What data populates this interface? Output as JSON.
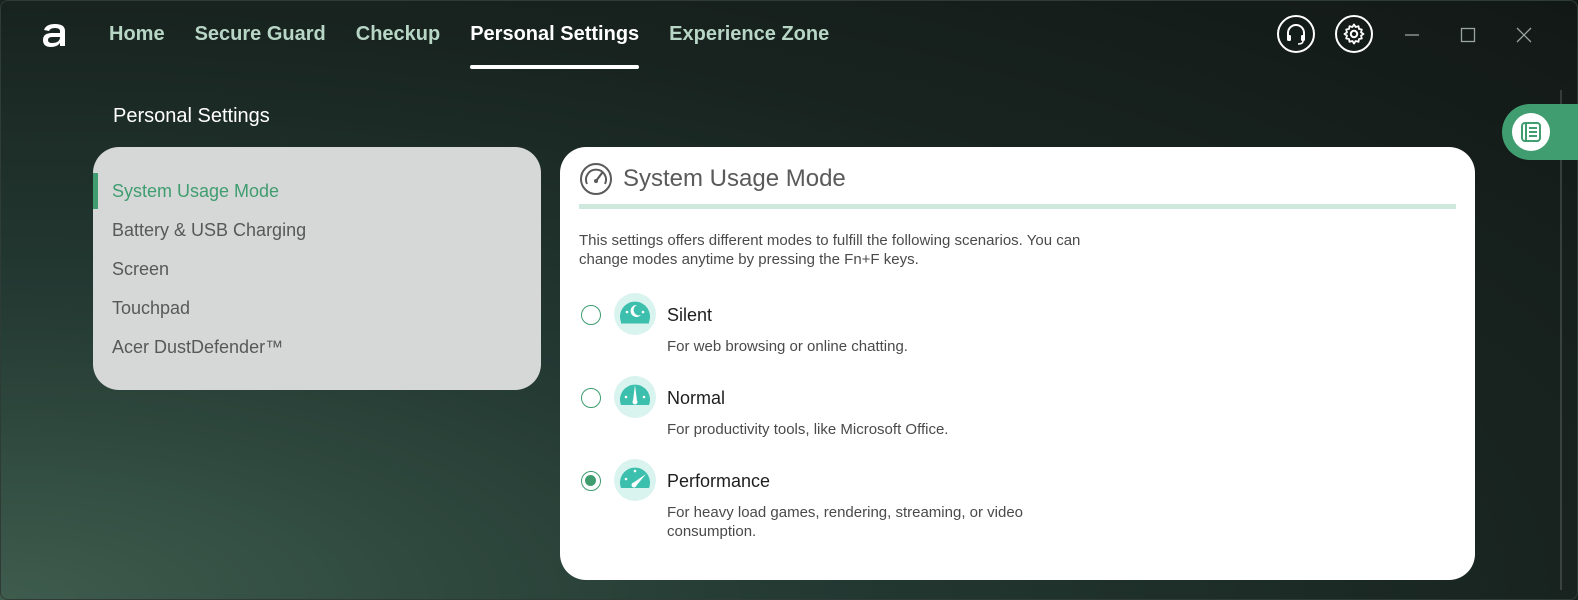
{
  "nav": {
    "tabs": [
      {
        "label": "Home"
      },
      {
        "label": "Secure Guard"
      },
      {
        "label": "Checkup"
      },
      {
        "label": "Personal Settings",
        "active": true
      },
      {
        "label": "Experience Zone"
      }
    ]
  },
  "header_icons": [
    "headset-icon",
    "gear-icon",
    "minimize-icon",
    "maximize-icon",
    "close-icon"
  ],
  "page": {
    "title": "Personal Settings"
  },
  "sidebar": {
    "items": [
      {
        "label": "System Usage Mode",
        "active": true
      },
      {
        "label": "Battery & USB Charging"
      },
      {
        "label": "Screen"
      },
      {
        "label": "Touchpad"
      },
      {
        "label": "Acer DustDefender™"
      }
    ]
  },
  "section": {
    "title": "System Usage Mode",
    "description": "This settings offers different modes to fulfill the following scenarios. You can change modes anytime by pressing the Fn+F keys.",
    "modes": [
      {
        "name": "Silent",
        "description": "For web browsing or online chatting.",
        "selected": false,
        "icon": "silent-gauge-icon"
      },
      {
        "name": "Normal",
        "description": "For productivity tools, like Microsoft Office.",
        "selected": false,
        "icon": "normal-gauge-icon"
      },
      {
        "name": "Performance",
        "description": "For heavy load games, rendering, streaming, or video consumption.",
        "selected": true,
        "icon": "performance-gauge-icon"
      }
    ]
  },
  "colors": {
    "accent": "#3f9d70",
    "nav_inactive": "#b8d6c6",
    "panel_left": "#d6d8d7",
    "icon_teal": "#3dbfae"
  }
}
